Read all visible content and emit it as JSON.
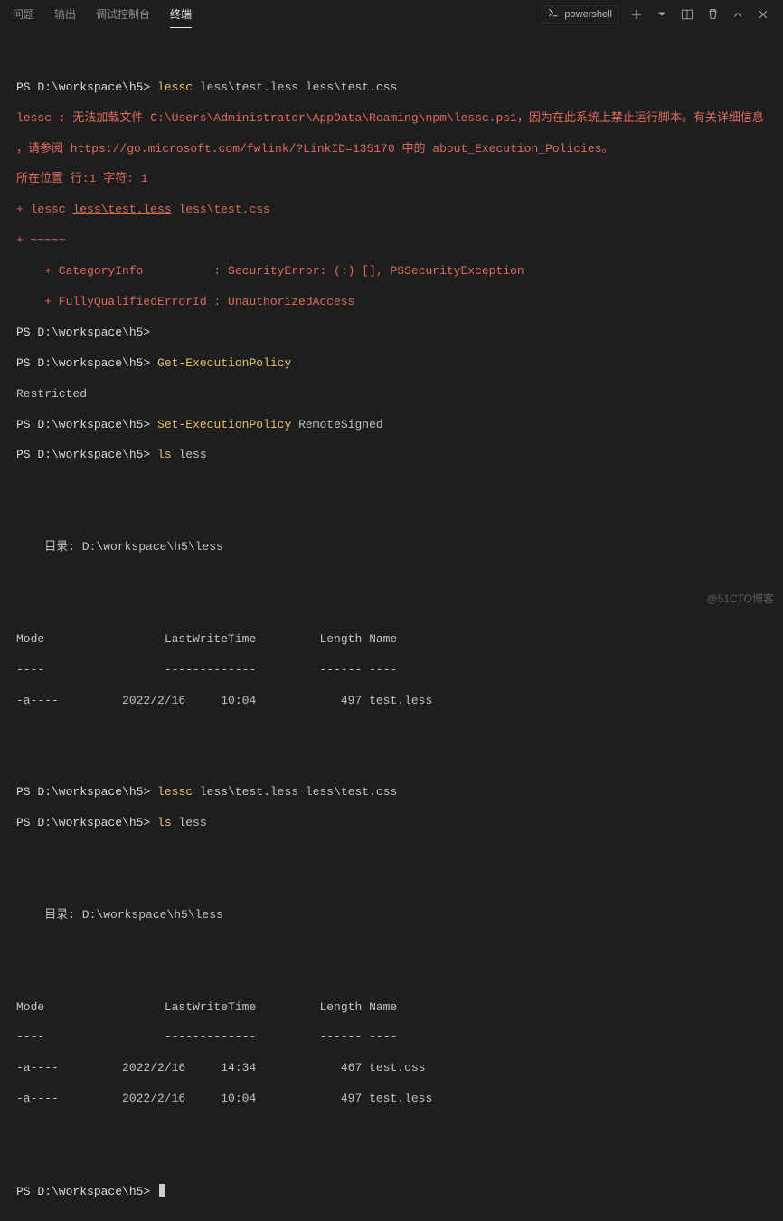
{
  "tabs": {
    "problems": "问题",
    "output": "输出",
    "debug": "调试控制台",
    "terminal": "终端"
  },
  "toolbar": {
    "shell": "powershell"
  },
  "ps_prompt": "PS D:\\workspace\\h5>",
  "cmd1": "lessc",
  "cmd1_args": " less\\test.less less\\test.css",
  "err1": "lessc : 无法加载文件 C:\\Users\\Administrator\\AppData\\Roaming\\npm\\lessc.ps1，因为在此系统上禁止运行脚本。有关详细信息",
  "err2": "，请参阅 https://go.microsoft.com/fwlink/?LinkID=135170 中的 about_Execution_Policies。",
  "err3": "所在位置 行:1 字符: 1",
  "err4a": "+ lessc ",
  "err4u": "less\\test.less",
  "err4b": " less\\test.css",
  "err5": "+ ~~~~~",
  "err6": "    + CategoryInfo          : SecurityError: (:) [], PSSecurityException",
  "err7": "    + FullyQualifiedErrorId : UnauthorizedAccess",
  "cmd2": "Get-ExecutionPolicy",
  "restricted": "Restricted",
  "cmd3": "Set-ExecutionPolicy",
  "cmd3_args": " RemoteSigned",
  "cmd4": "ls",
  "cmd4_args": " less",
  "dir1_label": "    目录: D:\\workspace\\h5\\less",
  "hdr": "Mode                 LastWriteTime         Length Name",
  "hdr2": "----                 -------------         ------ ----",
  "row1": "-a----         2022/2/16     10:04            497 test.less",
  "cmd5": "lessc",
  "cmd5_args": " less\\test.less less\\test.css",
  "cmd6": "ls",
  "cmd6_args": " less",
  "dir2_label": "    目录: D:\\workspace\\h5\\less",
  "row2a": "-a----         2022/2/16     14:34            467 test.css",
  "row2b": "-a----         2022/2/16     10:04            497 test.less",
  "watermark": "@51CTO博客"
}
